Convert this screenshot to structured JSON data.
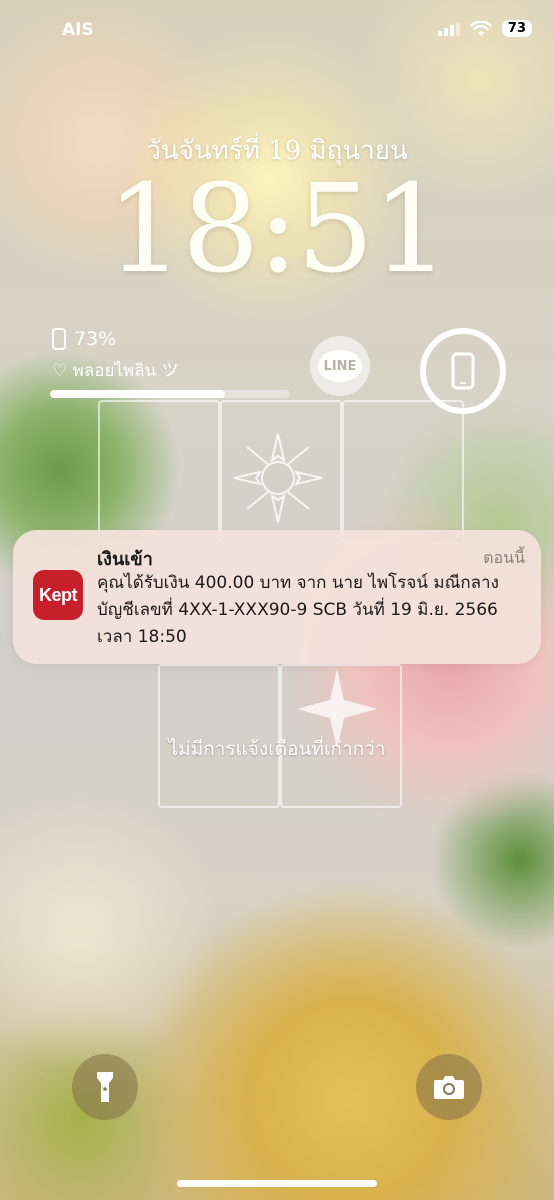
{
  "status_bar": {
    "carrier": "AIS",
    "battery_level": "73"
  },
  "lock_screen": {
    "date": "วันจันทร์ที่ 19 มิถุนายน",
    "time": "18:51"
  },
  "widgets": {
    "battery_percent_text": "73%",
    "battery_percent": 73,
    "note_text": "♡ พลอยไพลิน ツ",
    "line_label": "LINE"
  },
  "notification": {
    "title": "เงินเข้า",
    "time": "ตอนนี้",
    "app_icon_text": "Kept",
    "body": "คุณได้รับเงิน 400.00 บาท จาก นาย ไพโรจน์ มณีกลาง บัญชีเลขที่ 4XX-1-XXX90-9 SCB วันที่ 19 มิ.ย. 2566 เวลา 18:50"
  },
  "older_notifications_text": "ไม่มีการแจ้งเตือนที่เก่ากว่า",
  "icons": {
    "flashlight": "flashlight-icon",
    "camera": "camera-icon",
    "phone": "phone-icon",
    "wifi": "wifi-icon",
    "signal": "signal-icon"
  },
  "colors": {
    "kept_brand": "#c8202a",
    "notification_bg": "#f4e2dc"
  }
}
